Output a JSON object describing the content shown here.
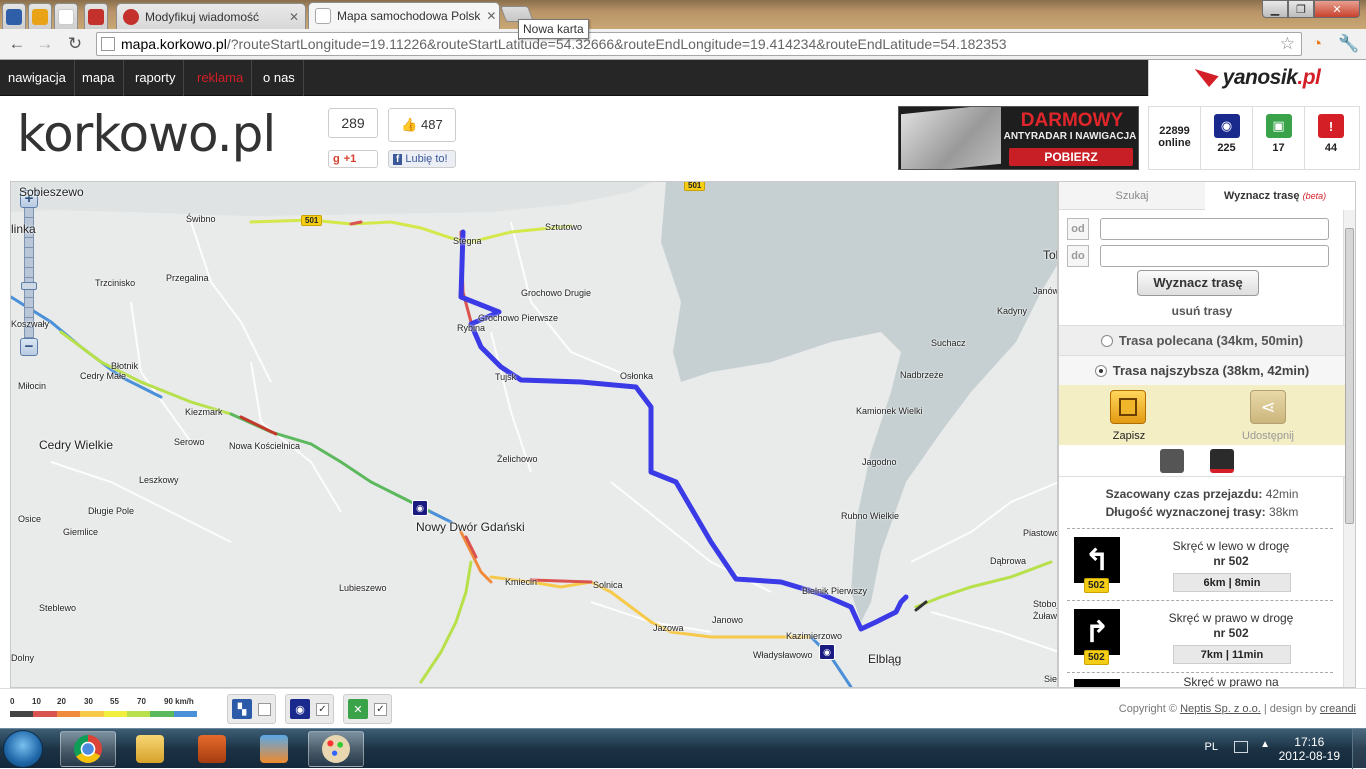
{
  "browser": {
    "tabs": [
      {
        "title": "Modyfikuj wiadomość",
        "active": false
      },
      {
        "title": "Mapa samochodowa Polsk",
        "active": true
      }
    ],
    "tooltip": "Nowa karta",
    "url_domain": "mapa.korkowo.pl",
    "url_path": "/?routeStartLongitude=19.11226&routeStartLatitude=54.32666&routeEndLongitude=19.414234&routeEndLatitude=54.182353"
  },
  "sitenav": {
    "items": [
      "nawigacja",
      "mapa",
      "raporty",
      "reklama",
      "o nas"
    ],
    "partner_logo": {
      "main": "yanosik",
      "tld": ".pl"
    }
  },
  "header": {
    "brand": "korkowo.pl",
    "gplus_count": "289",
    "gplus_label": "+1",
    "fb_count": "487",
    "fb_label": "Lubię to!",
    "ad": {
      "title": "DARMOWY",
      "subtitle": "ANTYRADAR I NAWIGACJA",
      "cta": "POBIERZ"
    },
    "stats": [
      {
        "value": "22899",
        "label": "online",
        "icon": "users-online"
      },
      {
        "value": "225",
        "icon": "speed-camera-icon",
        "color": "#1a2a8c"
      },
      {
        "value": "17",
        "icon": "police-icon",
        "color": "#3aa34a"
      },
      {
        "value": "44",
        "icon": "danger-icon",
        "color": "#d41f26"
      }
    ]
  },
  "map": {
    "places": [
      {
        "name": "Sobieszewo",
        "big": true
      },
      {
        "name": "Świbno"
      },
      {
        "name": "Stegna"
      },
      {
        "name": "Sztutowo"
      },
      {
        "name": "Trzcinisko"
      },
      {
        "name": "Przegalina"
      },
      {
        "name": "Grochowo Drugie"
      },
      {
        "name": "Grochowo Pierwsze"
      },
      {
        "name": "Rybina"
      },
      {
        "name": "Tujsk"
      },
      {
        "name": "Osłonka"
      },
      {
        "name": "Błotnik"
      },
      {
        "name": "Cedry Małe"
      },
      {
        "name": "Miłocin"
      },
      {
        "name": "Kiezmark"
      },
      {
        "name": "Serowo"
      },
      {
        "name": "Nowa Kościelnica"
      },
      {
        "name": "Cedry Wielkie",
        "big": true
      },
      {
        "name": "Leszkowy"
      },
      {
        "name": "Żelichowo"
      },
      {
        "name": "Długie Pole"
      },
      {
        "name": "Osice"
      },
      {
        "name": "Giemlice"
      },
      {
        "name": "Nowy Dwór Gdański",
        "big": true
      },
      {
        "name": "Kmiecin"
      },
      {
        "name": "Solnica"
      },
      {
        "name": "Lubieszewo"
      },
      {
        "name": "Steblewo"
      },
      {
        "name": "Jazowa"
      },
      {
        "name": "Janowo"
      },
      {
        "name": "Kazimierzowo"
      },
      {
        "name": "Władysławowo"
      },
      {
        "name": "Elbląg",
        "big": true
      },
      {
        "name": "Bielnik Pierwszy"
      },
      {
        "name": "Suchacz"
      },
      {
        "name": "Nadbrzeże"
      },
      {
        "name": "Kamionek Wielki"
      },
      {
        "name": "Jagodno"
      },
      {
        "name": "Rubno Wielkie"
      },
      {
        "name": "Kadyny"
      },
      {
        "name": "Janów"
      },
      {
        "name": "Tolkmicko"
      },
      {
        "name": "Piastowo"
      },
      {
        "name": "Dąbrowa"
      },
      {
        "name": "Stoboj"
      },
      {
        "name": "Sielno"
      },
      {
        "name": "Żuławki"
      },
      {
        "name": "Dolny"
      },
      {
        "name": "Koszwały"
      },
      {
        "name": "linka"
      }
    ],
    "road_badges": [
      "501",
      "501"
    ]
  },
  "panel": {
    "tab_search": "Szukaj",
    "tab_route": "Wyznacz trasę",
    "tab_route_beta": "(beta)",
    "from_label": "od",
    "to_label": "do",
    "route_button": "Wyznacz trasę",
    "clear_routes": "usuń trasy",
    "option_recommended": "Trasa polecana (34km, 50min)",
    "option_fastest": "Trasa najszybsza (38km, 42min)",
    "selected_option": "fastest",
    "save_label": "Zapisz",
    "share_label": "Udostępnij",
    "est_time_label": "Szacowany czas przejazdu:",
    "est_time_value": "42min",
    "length_label": "Długość wyznaczonej trasy:",
    "length_value": "38km",
    "steps": [
      {
        "instruction": "Skręć w lewo w drogę",
        "road": "nr 502",
        "badge": "502",
        "dist": "6km | 8min",
        "dir": "left"
      },
      {
        "instruction": "Skręć w prawo w drogę",
        "road": "nr 502",
        "badge": "502",
        "dist": "7km | 11min",
        "dir": "right"
      },
      {
        "instruction": "Skręć w prawo na",
        "road": "",
        "badge": "",
        "dist": "",
        "dir": "right"
      }
    ]
  },
  "footer": {
    "legend_ticks": [
      "0",
      "10",
      "20",
      "30",
      "55",
      "70",
      "90 km/h"
    ],
    "legend_colors": [
      "#444444",
      "#d9534f",
      "#f08a3c",
      "#f7c948",
      "#f2ee3d",
      "#b8e04a",
      "#5cb85c",
      "#4a90d9"
    ],
    "toggles": [
      {
        "icon": "traffic-icon",
        "checked": false
      },
      {
        "icon": "speed-camera-icon",
        "checked": true
      },
      {
        "icon": "roadwork-icon",
        "checked": true
      }
    ],
    "copyright_prefix": "Copyright ©",
    "copyright_company": "Neptis Sp. z o.o.",
    "design_by": "| design by",
    "designer": "creandi"
  },
  "taskbar": {
    "lang": "PL",
    "time": "17:16",
    "date": "2012-08-19"
  }
}
